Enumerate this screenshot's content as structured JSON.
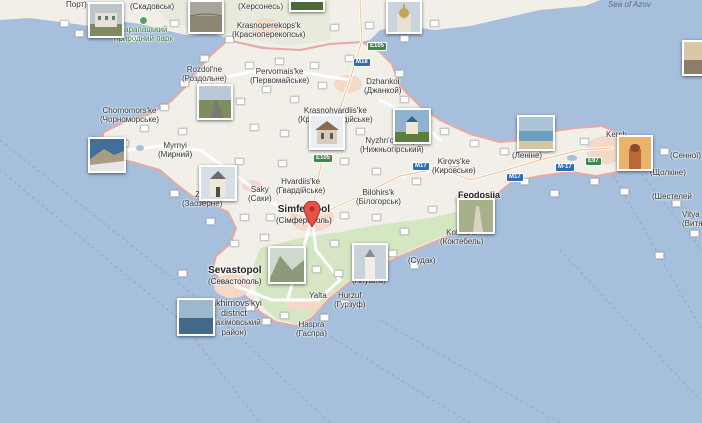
{
  "map": {
    "colors": {
      "water": "#a5bfdd",
      "land": "#f2efe9",
      "forest": "#cfe3bc",
      "urban": "#f3d6c5",
      "road": "#ffffff"
    },
    "marker": {
      "icon": "red-map-pin"
    },
    "labels": {
      "port": "Порт)",
      "skadovsk": "(Скадовськ)",
      "hersones": "(Херсонесь)",
      "krasnoperekops_lat": "Krasnoperekops'k",
      "krasnoperekops_cyr": "(Красноперекопськ)",
      "park_1": "Карапацький",
      "park_2": "природний парк",
      "sea_of_azov": "Sea of Azov",
      "rozdolne_lat": "Rozdol'ne",
      "rozdolne_cyr": "(Роздольне)",
      "pervomaiske_lat": "Pervomais'ke",
      "pervomaiske_cyr": "(Первомайське)",
      "dzhankoi_lat": "Dzhankoi",
      "dzhankoi_cyr": "(Джанкой)",
      "chornomorske_lat": "Chornomors'ke",
      "chornomorske_cyr": "(Чорноморське)",
      "krasnohvardiiske_lat": "Krasnohvardiis'ke",
      "krasnohvardiiske_cyr": "(Красногвардійське)",
      "nyzhnohirskyi_lat": "Nyzhn'ohirs'kyi",
      "nyzhnohirskyi_cyr": "(Нижньогірський)",
      "kerch": "Kerch",
      "lenine": "(Леніне)",
      "senoi": "(Сенної)",
      "myrnyi_lat": "Myrnyi",
      "myrnyi_cyr": "(Мирний)",
      "kirovske_lat": "Kirovs'ke",
      "kirovske_cyr": "(Кировське)",
      "feodosiia": "Feodosiia",
      "hvardiiske_lat": "Hvardiis'ke",
      "hvardiiske_cyr": "(Гвардійське)",
      "saky_lat": "Saky",
      "saky_cyr": "(Саки)",
      "bilohirsk_lat": "Bilohirs'k",
      "bilohirsk_cyr": "(Білогорськ)",
      "zaozerne_lat": "Zao",
      "zaozerne_cyr": "(Заозерне)",
      "simferopol_lat": "Simferopol",
      "simferopol_cyr": "(Сімферополь)",
      "koktebel_lat": "Koktebel",
      "koktebel_cyr": "(Коктебель)",
      "sudak": "(Судак)",
      "sevastopol_lat": "Sevastopol",
      "sevastopol_cyr": "(Севастополь)",
      "alushta": "(Алушта)",
      "nakhimovskyi_lat": "hakhimovs'kyi",
      "nakhimovskyi_district": "district",
      "nakhimovskyi_cyr": "(Нахімовський район)",
      "yalta": "Yalta",
      "hurzuf_lat": "Hurzuf",
      "hurzuf_cyr": "(Гурзуф)",
      "haspra_lat": "Haspra",
      "haspra_cyr": "(Гаспра)",
      "vityaz_lat": "Vitya",
      "vityaz_cyr": "(Витязе",
      "shcholkine": "(Щолкіне)",
      "shesteleiv": "(Шестелей"
    },
    "roads": {
      "e105_north": "E105",
      "m18": "M18",
      "e105_mid": "E105",
      "m17": "M17",
      "m17_east": "M17",
      "e97": "E97",
      "m17_far": "M-17"
    }
  }
}
